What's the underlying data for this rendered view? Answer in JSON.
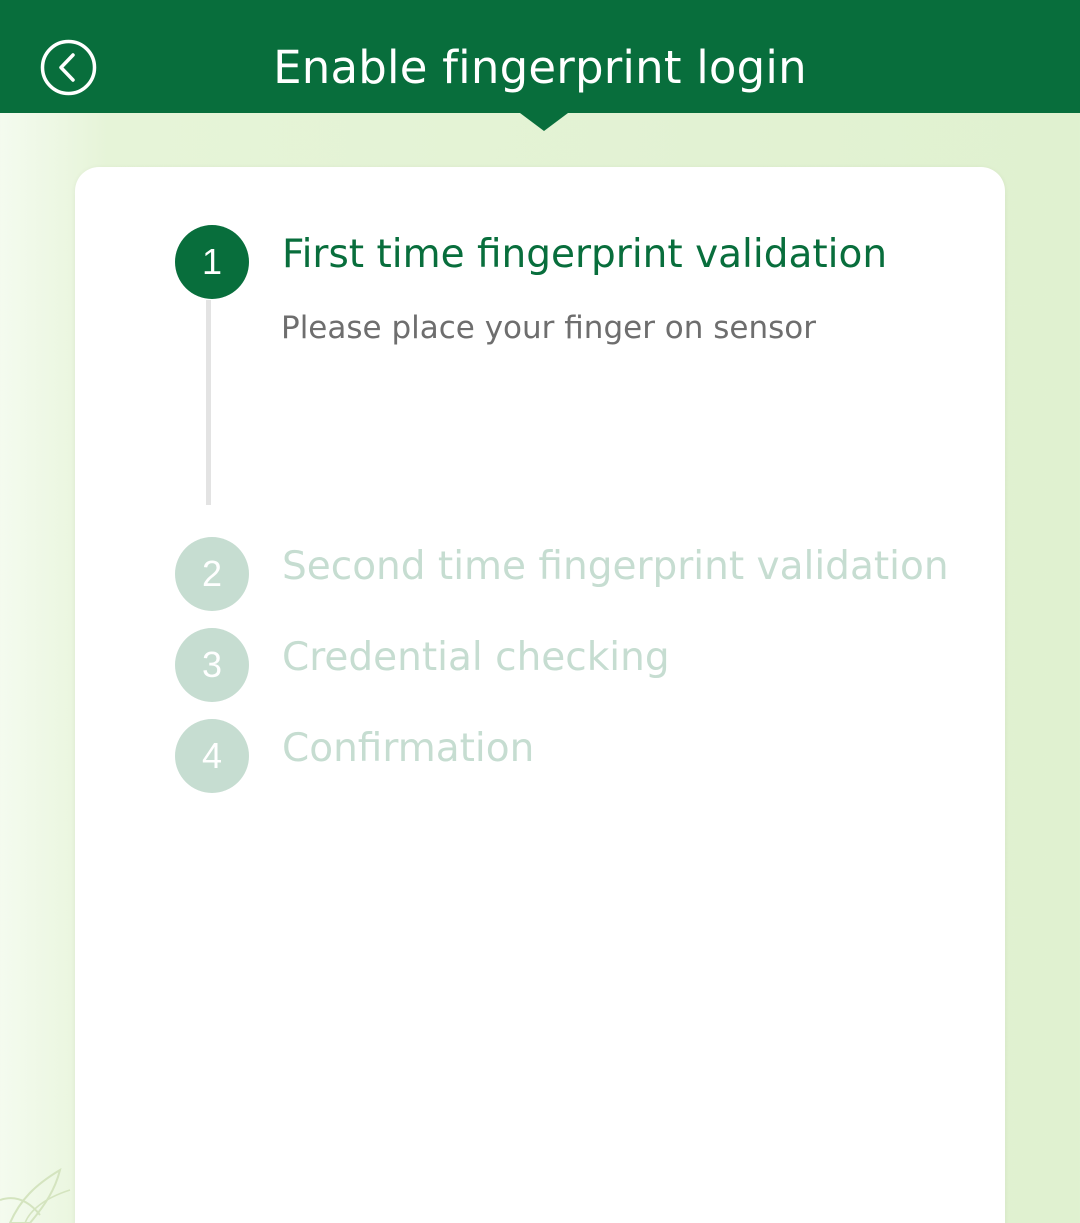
{
  "header": {
    "title": "Enable fingerprint login",
    "back_icon": "chevron-left-circle-icon",
    "color": "#086e3c"
  },
  "steps": [
    {
      "number": "1",
      "title": "First time fingerprint validation",
      "description": "Please place your finger on sensor",
      "state": "active"
    },
    {
      "number": "2",
      "title": "Second time fingerprint validation",
      "state": "pending"
    },
    {
      "number": "3",
      "title": "Credential checking",
      "state": "pending"
    },
    {
      "number": "4",
      "title": "Confirmation",
      "state": "pending"
    }
  ],
  "colors": {
    "active": "#086e3c",
    "pending": "#c6ddd1",
    "background": "#e0f1d0"
  }
}
